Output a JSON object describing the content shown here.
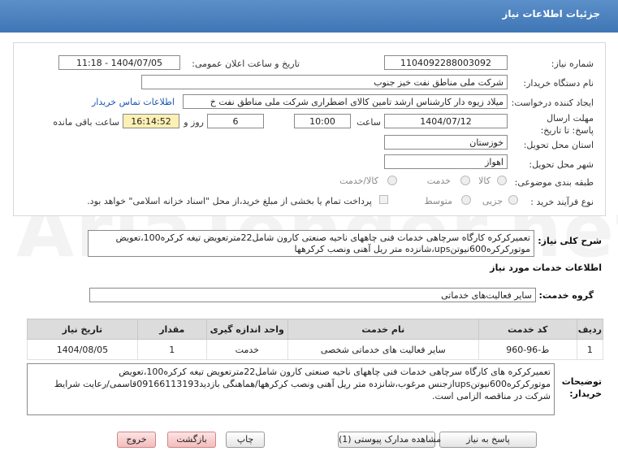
{
  "header": {
    "title": "جزئیات اطلاعات نیاز"
  },
  "form": {
    "need_number_label": "شماره نیاز:",
    "need_number": "1104092288003092",
    "announce_label": "تاریخ و ساعت اعلان عمومی:",
    "announce_value": "1404/07/05 - 11:18",
    "buyer_label": "نام دستگاه خریدار:",
    "buyer_value": "شرکت ملی مناطق نفت خیز جنوب",
    "creator_label": "ایجاد کننده درخواست:",
    "creator_value": "میلاد زیوه دار  کارشناس ارشد تامین کالای اضطراری شرکت ملی مناطق نفت خ",
    "contact_link": "اطلاعات تماس خریدار",
    "deadline_label": "مهلت ارسال پاسخ: تا تاریخ:",
    "deadline_date": "1404/07/12",
    "time_label": "ساعت",
    "deadline_time": "10:00",
    "days_value": "6",
    "days_label": "روز و",
    "remaining_time": "16:14:52",
    "remaining_label": "ساعت باقی مانده",
    "province_label": "استان محل تحویل:",
    "province_value": "خوزستان",
    "city_label": "شهر محل تحویل:",
    "city_value": "اهواز",
    "category_label": "طبقه بندی موضوعی:",
    "category_options": [
      "کالا",
      "خدمت",
      "کالا/خدمت"
    ],
    "purchase_label": "نوع فرآیند خرید :",
    "purchase_options": [
      "جزیی",
      "متوسط"
    ],
    "payment_note": "پرداخت تمام یا بخشی از مبلغ خرید،از محل \"اسناد خزانه اسلامی\" خواهد بود."
  },
  "summary": {
    "label": "شرح کلی نیاز:",
    "text": "تعمیرکرکره کارگاه سرچاهی خدمات فنی چاههای ناحیه صنعتی کارون شامل22مترتعویض تیغه کرکره100،تعویض موتورکرکره600نیوتنups،شانزده متر ریل آهنی ونصب کرکرهها"
  },
  "services": {
    "section_title": "اطلاعات خدمات مورد نیاز",
    "group_label": "گروه خدمت:",
    "group_value": "سایر فعالیت‌های خدماتی",
    "columns": [
      "ردیف",
      "کد خدمت",
      "نام خدمت",
      "واحد اندازه گیری",
      "مقدار",
      "تاریخ نیاز"
    ],
    "rows": [
      [
        "1",
        "ط-96-960",
        "سایر فعالیت های خدماتی شخصی",
        "خدمت",
        "1",
        "1404/08/05"
      ]
    ]
  },
  "buyer_notes": {
    "label": "توضیحات خریدار:",
    "text": "تعمیرکرکره های کارگاه سرچاهی خدمات فنی چاههای ناحیه صنعتی کارون شامل22مترتعویض تیغه کرکره100،تعویض موتورکرکره600نیوتنupsازجنس مرغوب،شانزده متر ریل آهنی ونصب کرکرهها/هماهنگی بازدید09166113193قاسمی/رعایت شرایط شرکت در مناقصه الزامی است."
  },
  "buttons": {
    "reply": "پاسخ به نیاز",
    "attachments": "مشاهده مدارک پیوستی (1)",
    "print": "چاپ",
    "back": "بازگشت",
    "exit": "خروج"
  },
  "watermark": "AriaTender.net"
}
